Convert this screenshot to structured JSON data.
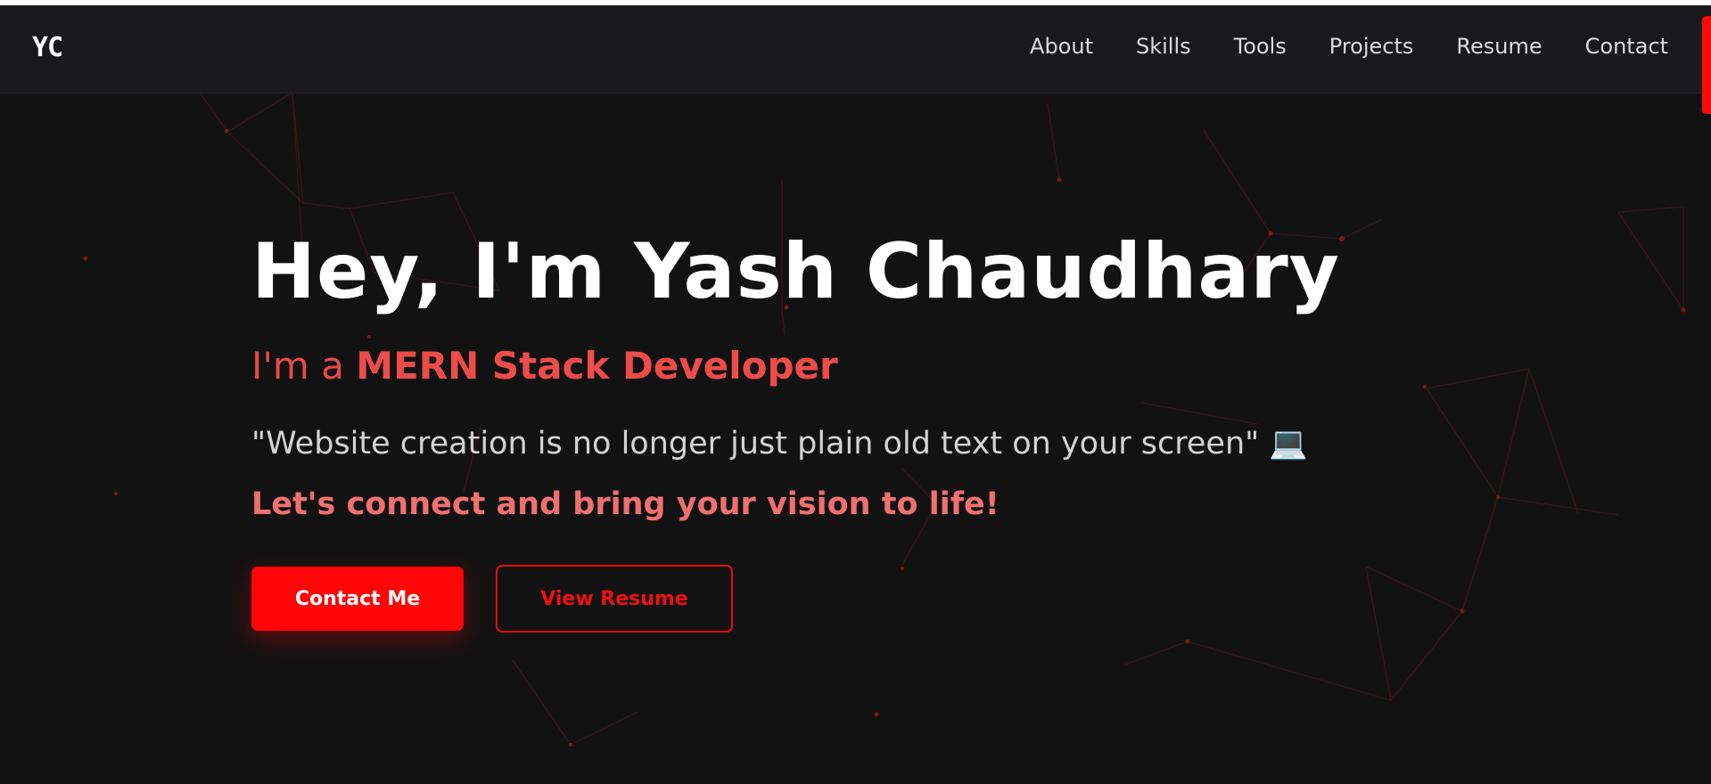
{
  "nav": {
    "logo": "YC",
    "links": [
      "About",
      "Skills",
      "Tools",
      "Projects",
      "Resume",
      "Contact"
    ]
  },
  "hero": {
    "title": "Hey, I'm Yash Chaudhary",
    "subtitle_prefix": "I'm a ",
    "subtitle_role": "MERN Stack Developer",
    "quote": "\"Website creation is no longer just plain old text on your screen\" 💻",
    "cta_text": "Let's connect and bring your vision to life!",
    "primary_button": "Contact Me",
    "secondary_button": "View Resume"
  },
  "colors": {
    "background": "#131213",
    "navbar": "#19181a",
    "accent": "#ff0505",
    "accent_soft": "#ee4b4b"
  }
}
